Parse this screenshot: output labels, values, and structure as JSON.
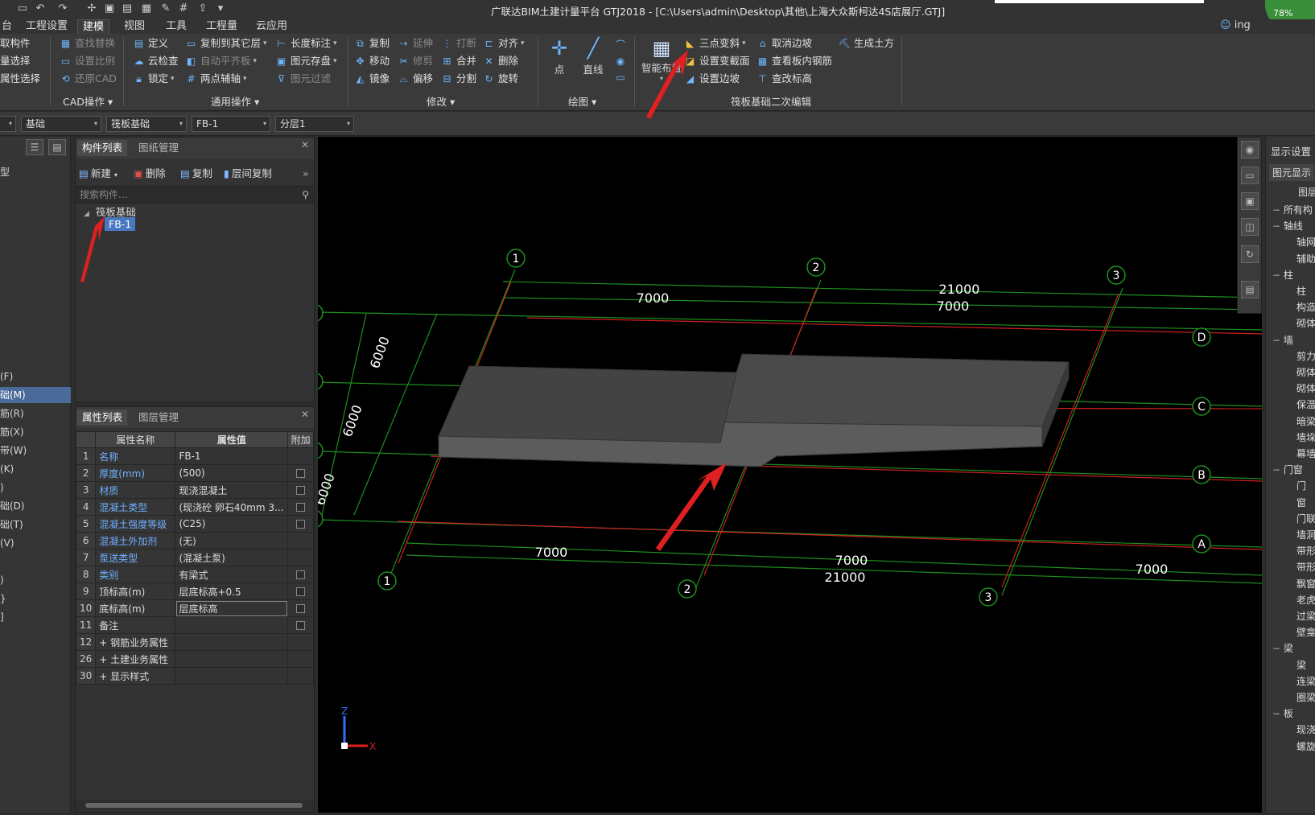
{
  "window": {
    "title": "广联达BIM土建计量平台 GTJ2018 - [C:\\Users\\admin\\Desktop\\其他\\上海大众斯柯达4S店展厅.GTJ]",
    "user": "ing",
    "progress_badge": "78%"
  },
  "menu": {
    "tabs": [
      "台",
      "工程设置",
      "建模",
      "视图",
      "工具",
      "工程量",
      "云应用"
    ],
    "active": "建模"
  },
  "ribbon": {
    "select_group": {
      "items": [
        "取构件",
        "量选择",
        "属性选择"
      ]
    },
    "cad_group": {
      "items": [
        "查找替换",
        "设置比例",
        "还原CAD"
      ],
      "label": "CAD操作"
    },
    "general_group": {
      "items": [
        "定义",
        "云检查",
        "锁定",
        "复制到其它层",
        "自动平齐板",
        "两点辅轴",
        "长度标注",
        "图元存盘",
        "图元过滤"
      ],
      "label": "通用操作"
    },
    "modify_group": {
      "items": [
        "复制",
        "移动",
        "镜像",
        "延伸",
        "修剪",
        "偏移",
        "打断",
        "合并",
        "分割",
        "对齐",
        "删除",
        "旋转"
      ],
      "label": "修改"
    },
    "draw_group": {
      "items": [
        "点",
        "直线"
      ],
      "label": "绘图"
    },
    "raft_group": {
      "smart": "智能布置",
      "items": [
        "三点变斜",
        "设置变截面",
        "设置边坡",
        "取消边坡",
        "查看板内钢筋",
        "查改标高",
        "生成土方"
      ],
      "label": "筏板基础二次编辑"
    }
  },
  "selectors": [
    "基础",
    "筏板基础",
    "FB-1",
    "分层1"
  ],
  "left_nav": {
    "items": [
      "型",
      "(F)",
      "础(M)",
      "筋(R)",
      "筋(X)",
      "带(W)",
      "(K)",
      ")",
      "础(D)",
      "础(T)",
      "(V)",
      ")",
      "}",
      "]"
    ],
    "selected": "础(M)"
  },
  "component_list": {
    "tabs": [
      "构件列表",
      "图纸管理"
    ],
    "toolbar": [
      "新建",
      "删除",
      "复制",
      "层间复制"
    ],
    "search_placeholder": "搜索构件...",
    "tree_root": "筏板基础",
    "tree_item": "FB-1"
  },
  "properties": {
    "tabs": [
      "属性列表",
      "图层管理"
    ],
    "headers": [
      "属性名称",
      "属性值",
      "附加"
    ],
    "rows": [
      {
        "no": "1",
        "name": "名称",
        "value": "FB-1",
        "check": false
      },
      {
        "no": "2",
        "name": "厚度(mm)",
        "value": "(500)",
        "check": true
      },
      {
        "no": "3",
        "name": "材质",
        "value": "现浇混凝土",
        "check": true
      },
      {
        "no": "4",
        "name": "混凝土类型",
        "value": "(现浇砼 卵石40mm 3...",
        "check": true
      },
      {
        "no": "5",
        "name": "混凝土强度等级",
        "value": "(C25)",
        "check": true
      },
      {
        "no": "6",
        "name": "混凝土外加剂",
        "value": "(无)",
        "check": false
      },
      {
        "no": "7",
        "name": "泵送类型",
        "value": "(混凝土泵)",
        "check": false
      },
      {
        "no": "8",
        "name": "类别",
        "value": "有梁式",
        "check": true
      },
      {
        "no": "9",
        "name": "顶标高(m)",
        "value": "层底标高+0.5",
        "check": true
      },
      {
        "no": "10",
        "name": "底标高(m)",
        "value": "层底标高",
        "check": true
      },
      {
        "no": "11",
        "name": "备注",
        "value": "",
        "check": true
      },
      {
        "no": "12",
        "name": "+ 钢筋业务属性",
        "value": "",
        "check": false
      },
      {
        "no": "26",
        "name": "+ 土建业务属性",
        "value": "",
        "check": false
      },
      {
        "no": "30",
        "name": "+ 显示样式",
        "value": "",
        "check": false
      }
    ]
  },
  "viewport": {
    "axis_labels": [
      "1",
      "2",
      "3",
      "D",
      "C",
      "B",
      "A"
    ],
    "dims": {
      "top_total": "21000",
      "top_span": "7000",
      "side": "6000",
      "bottom_total": "21000",
      "bottom_span": "7000"
    },
    "axis_x": "X",
    "axis_z": "Z",
    "colors": {
      "grid": "#1f8f1f",
      "axis_red": "#d02020",
      "slab": "#555555",
      "arrow": "#e02020"
    }
  },
  "right_panel": {
    "title": "显示设置",
    "sub": "图元显示",
    "header": "图层",
    "items": [
      "所有构",
      "轴线",
      "轴网",
      "辅助",
      "柱",
      "柱",
      "构造",
      "砌体",
      "墙",
      "剪力",
      "砌体",
      "砌体",
      "保温",
      "暗梁",
      "墙垛",
      "幕墙",
      "门窗",
      "门",
      "窗",
      "门联",
      "墙洞",
      "带形",
      "带形",
      "飘窗",
      "老虎",
      "过梁",
      "壁龛",
      "梁",
      "梁",
      "连梁",
      "圈梁",
      "板",
      "现浇",
      "螺旋"
    ]
  }
}
